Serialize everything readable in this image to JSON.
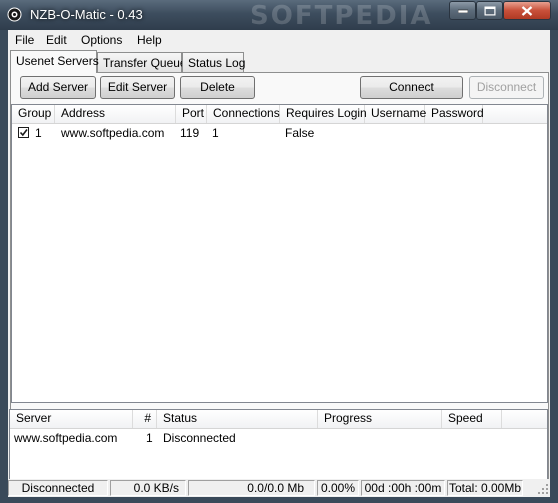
{
  "window": {
    "title": "NZB-O-Matic - 0.43",
    "watermark": "SOFTPEDIA"
  },
  "menu": [
    "File",
    "Edit",
    "Options",
    "Help"
  ],
  "tabs": [
    {
      "label": "Usenet Servers",
      "active": true
    },
    {
      "label": "Transfer Queue",
      "active": false
    },
    {
      "label": "Status Log",
      "active": false
    }
  ],
  "toolbar": {
    "add_server": "Add Server",
    "edit_server": "Edit Server",
    "delete": "Delete",
    "connect": "Connect",
    "disconnect": "Disconnect"
  },
  "servers_table": {
    "columns": [
      "Group",
      "Address",
      "Port",
      "Connections",
      "Requires Login",
      "Username",
      "Password"
    ],
    "rows": [
      {
        "checked": true,
        "group": "1",
        "address": "www.softpedia.com",
        "port": "119",
        "connections": "1",
        "requires_login": "False",
        "username": "",
        "password": ""
      }
    ]
  },
  "connections_table": {
    "columns": [
      "Server",
      "#",
      "Status",
      "Progress",
      "Speed"
    ],
    "rows": [
      {
        "server": "www.softpedia.com",
        "num": "1",
        "status": "Disconnected",
        "progress": "",
        "speed": ""
      }
    ]
  },
  "statusbar": {
    "state": "Disconnected",
    "speed": "0.0 KB/s",
    "size": "0.0/0.0 Mb",
    "percent": "0.00%",
    "time": "00d :00h :00m",
    "total": "Total: 0.00Mb"
  }
}
